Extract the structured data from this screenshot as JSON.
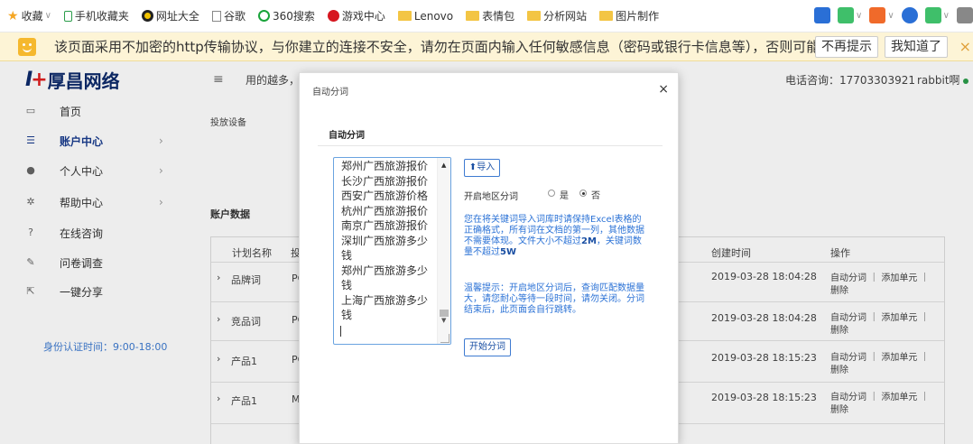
{
  "bookmarks": {
    "items": [
      {
        "label": "收藏"
      },
      {
        "label": "手机收藏夹"
      },
      {
        "label": "网址大全"
      },
      {
        "label": "谷歌"
      },
      {
        "label": "360搜索"
      },
      {
        "label": "游戏中心"
      },
      {
        "label": "Lenovo"
      },
      {
        "label": "表情包"
      },
      {
        "label": "分析网站"
      },
      {
        "label": "图片制作"
      }
    ]
  },
  "warning": {
    "text": "该页面采用不加密的http传输协议，与你建立的连接不安全，请勿在页面内输入任何敏感信息（密码或银行卡信息等），否则可能会...",
    "dismiss_label": "不再提示",
    "ok_label": "我知道了",
    "close_glyph": "×"
  },
  "header": {
    "logo_text": "厚昌网络",
    "menu_glyph": "≡",
    "hint": "用的越多，",
    "phone": "电话咨询：17703303921",
    "user": "rabbit啊"
  },
  "sidebar": {
    "items": [
      {
        "label": "首页",
        "icon": "monitor-icon"
      },
      {
        "label": "账户中心",
        "icon": "list-icon",
        "active": true
      },
      {
        "label": "个人中心",
        "icon": "users-icon"
      },
      {
        "label": "帮助中心",
        "icon": "gears-icon"
      },
      {
        "label": "在线咨询",
        "icon": "question-icon"
      },
      {
        "label": "问卷调查",
        "icon": "edit-icon"
      },
      {
        "label": "一键分享",
        "icon": "share-icon"
      }
    ],
    "auth_time": "身份认证时间：9:00-18:00"
  },
  "main": {
    "device_label": "投放设备",
    "section_label": "账户数据",
    "columns": [
      "计划名称",
      "投",
      "创建时间",
      "操作"
    ],
    "rows": [
      {
        "name": "品牌词",
        "mid": "PC",
        "created": "2019-03-28 18:04:28"
      },
      {
        "name": "竞品词",
        "mid": "PC",
        "created": "2019-03-28 18:04:28"
      },
      {
        "name": "产品1",
        "mid": "PC",
        "created": "2019-03-28 18:15:23"
      },
      {
        "name": "产品1",
        "mid": "M",
        "created": "2019-03-28 18:15:23"
      }
    ],
    "ops_line1": "自动分词 ｜ 添加单元 ｜",
    "ops_line2": "删除"
  },
  "modal": {
    "title": "自动分词",
    "close_glyph": "×",
    "section_title": "自动分词",
    "keywords": [
      "郑州广西旅游报价",
      "长沙广西旅游报价",
      "西安广西旅游价格",
      "杭州广西旅游报价",
      "南京广西旅游报价",
      "深圳广西旅游多少钱",
      "郑州广西旅游多少钱",
      "上海广西旅游多少钱"
    ],
    "import_label": "导入",
    "region_label": "开启地区分词",
    "radio_yes": "是",
    "radio_no": "否",
    "region_enabled": false,
    "info_text": "您在将关键词导入词库时请保持Excel表格的正确格式，所有词在文档的第一列，其他数据不需要体现。文件大小不超过",
    "info_size": "2M",
    "info_mid": "，关键词数量不超过",
    "info_count": "5W",
    "tip_text": "温馨提示：开启地区分词后，查询匹配数据量大，请您耐心等待一段时间，请勿关闭。分词结束后，此页面会自行跳转。",
    "start_label": "开始分词"
  },
  "colors": {
    "accent": "#1a3d8f",
    "link_blue": "#2b72d6",
    "warning_bg": "#fdf4d6",
    "online": "#2a9d4a"
  }
}
